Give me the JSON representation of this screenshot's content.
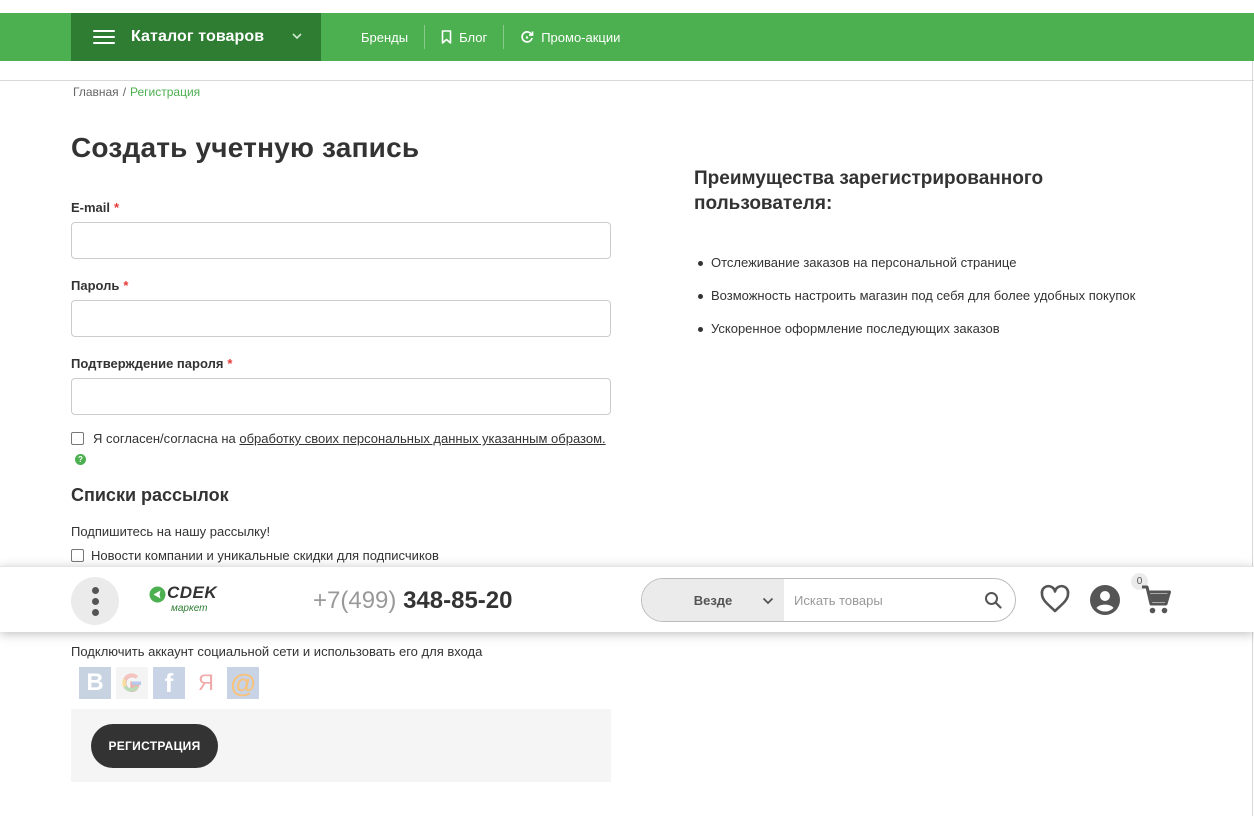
{
  "nav": {
    "catalog_label": "Каталог товаров",
    "links": [
      {
        "label": "Бренды",
        "icon": ""
      },
      {
        "label": "Блог",
        "icon": "bookmark-icon"
      },
      {
        "label": "Промо-акции",
        "icon": "refresh-icon"
      }
    ]
  },
  "breadcrumb": {
    "home": "Главная",
    "separator": "/",
    "current": "Регистрация"
  },
  "form": {
    "title": "Создать учетную запись",
    "required_mark": "*",
    "email_label": "E-mail",
    "email_value": "",
    "password_label": "Пароль",
    "password_value": "",
    "confirm_label": "Подтверждение пароля",
    "confirm_value": "",
    "agree_prefix": "Я согласен/согласна на ",
    "agree_link": "обработку своих персональных данных указанным образом.",
    "agree_help": "?"
  },
  "newsletter": {
    "title": "Списки рассылок",
    "subtitle": "Подпишитесь на нашу рассылку!",
    "option": "Новости компании и уникальные скидки для подписчиков"
  },
  "benefits": {
    "title": "Преимущества зарегистрированного пользователя:",
    "items": [
      "Отслеживание заказов на персональной странице",
      "Возможность настроить магазин под себя для более удобных покупок",
      "Ускоренное оформление последующих заказов"
    ]
  },
  "header_sticky": {
    "logo_text": "CDEK",
    "logo_sub": "маркет",
    "phone_prefix": "+7(499)",
    "phone_number": "348-85-20",
    "search_scope": "Везде",
    "search_placeholder": "Искать товары",
    "cart_count": "0"
  },
  "social": {
    "text": "Подключить аккаунт социальной сети и использовать его для входа",
    "vk_glyph": "В",
    "fb_glyph": "f",
    "ya_glyph": "Я",
    "mail_glyph": "@"
  },
  "register_button": "РЕГИСТРАЦИЯ",
  "colors": {
    "brand_green": "#4caf50",
    "brand_green_dark": "#2e7d32",
    "required": "#e53935",
    "button_dark": "#333333"
  }
}
